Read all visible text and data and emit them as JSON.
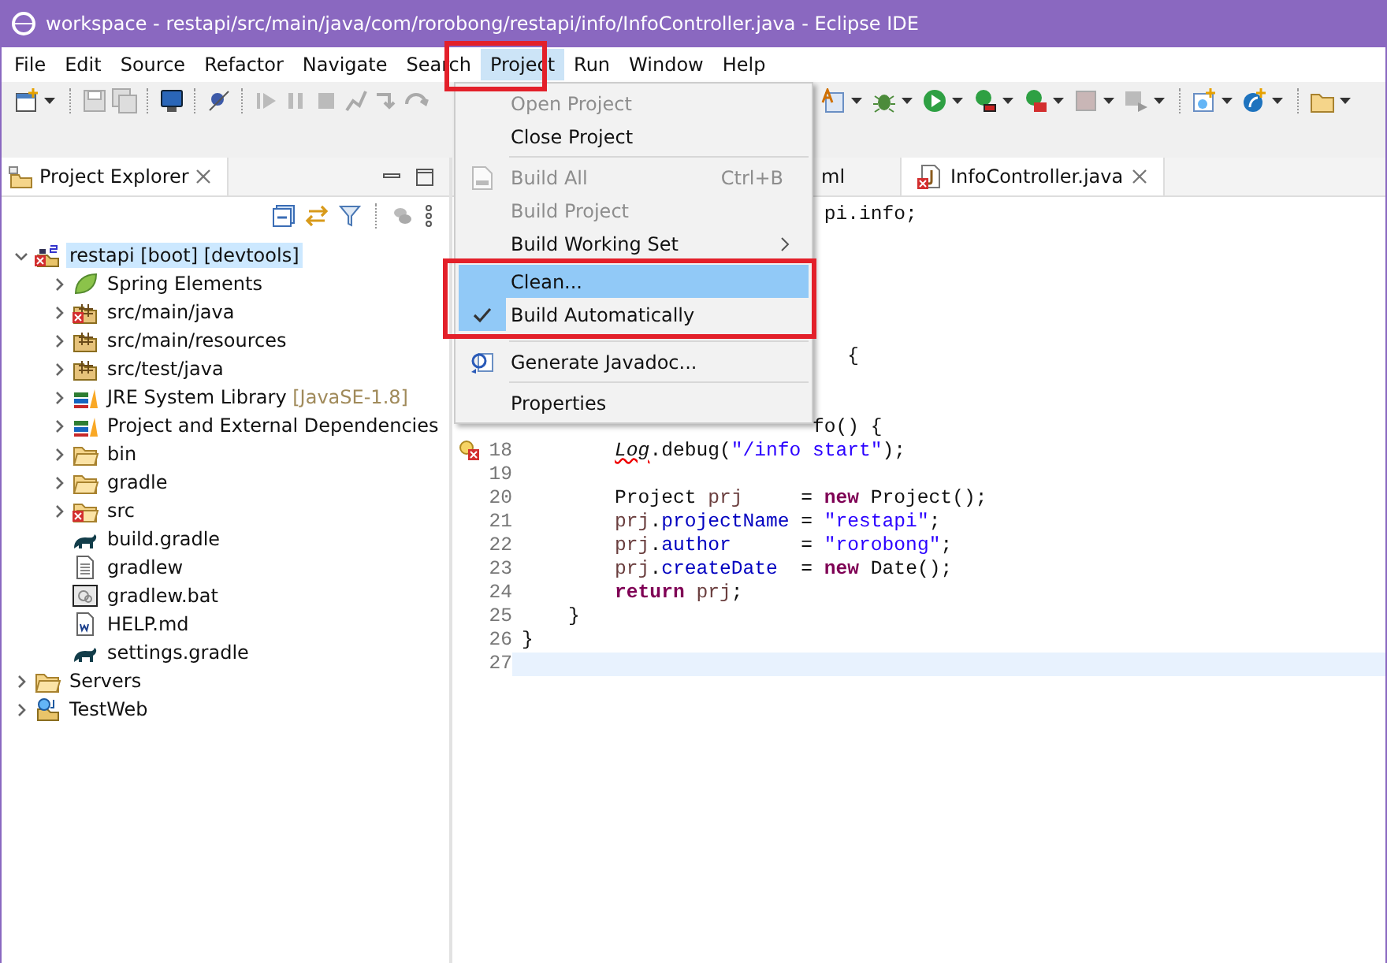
{
  "window": {
    "title": "workspace - restapi/src/main/java/com/rorobong/restapi/info/InfoController.java - Eclipse IDE"
  },
  "menubar": [
    {
      "label": "File",
      "selected": false
    },
    {
      "label": "Edit",
      "selected": false
    },
    {
      "label": "Source",
      "selected": false
    },
    {
      "label": "Refactor",
      "selected": false
    },
    {
      "label": "Navigate",
      "selected": false
    },
    {
      "label": "Search",
      "selected": false
    },
    {
      "label": "Project",
      "selected": true
    },
    {
      "label": "Run",
      "selected": false
    },
    {
      "label": "Window",
      "selected": false
    },
    {
      "label": "Help",
      "selected": false
    }
  ],
  "project_explorer": {
    "title": "Project Explorer",
    "tree": [
      {
        "label": "restapi [boot] [devtools]",
        "kind": "project",
        "error": true,
        "expanded": true,
        "selected": true,
        "children": [
          {
            "label": "Spring Elements",
            "kind": "spring",
            "expanded": false,
            "selected": false
          },
          {
            "label": "src/main/java",
            "kind": "package",
            "error": true,
            "expanded": false,
            "selected": false
          },
          {
            "label": "src/main/resources",
            "kind": "package",
            "expanded": false,
            "selected": false
          },
          {
            "label": "src/test/java",
            "kind": "package",
            "expanded": false,
            "selected": false
          },
          {
            "label": "JRE System Library",
            "decoration": "[JavaSE-1.8]",
            "kind": "library",
            "expanded": false,
            "selected": false
          },
          {
            "label": "Project and External Dependencies",
            "kind": "library",
            "expanded": false,
            "selected": false
          },
          {
            "label": "bin",
            "kind": "folder",
            "expanded": false,
            "selected": false
          },
          {
            "label": "gradle",
            "kind": "folder",
            "expanded": false,
            "selected": false
          },
          {
            "label": "src",
            "kind": "folder",
            "error": true,
            "expanded": false,
            "selected": false
          },
          {
            "label": "build.gradle",
            "kind": "gradle",
            "selected": false
          },
          {
            "label": "gradlew",
            "kind": "file",
            "selected": false
          },
          {
            "label": "gradlew.bat",
            "kind": "bat",
            "selected": false
          },
          {
            "label": "HELP.md",
            "kind": "doc",
            "selected": false
          },
          {
            "label": "settings.gradle",
            "kind": "gradle",
            "selected": false
          }
        ]
      },
      {
        "label": "Servers",
        "kind": "folder",
        "expanded": false,
        "selected": false
      },
      {
        "label": "TestWeb",
        "kind": "webproject",
        "expanded": false,
        "selected": false
      }
    ]
  },
  "editor": {
    "tabs": [
      {
        "label": "ml",
        "selected": false
      },
      {
        "label": "InfoController.java",
        "selected": true
      }
    ],
    "covered_lines": [
      {
        "text": "                          pi.info;"
      },
      {
        "text": "                            {"
      },
      {
        "text": "                         fo() {"
      }
    ],
    "lines": [
      {
        "number": "18",
        "error": true,
        "tokens": [
          {
            "kind": "static",
            "text": "        Log"
          },
          {
            "kind": "plain",
            "text": ".debug("
          },
          {
            "kind": "string",
            "text": "\"/info start\""
          },
          {
            "kind": "plain",
            "text": ");"
          }
        ]
      },
      {
        "number": "19"
      },
      {
        "number": "20",
        "tokens": [
          {
            "kind": "plain",
            "text": "        Project "
          },
          {
            "kind": "local",
            "text": "prj"
          },
          {
            "kind": "plain",
            "text": "     = "
          },
          {
            "kind": "keyword",
            "text": "new"
          },
          {
            "kind": "plain",
            "text": " Project();"
          }
        ]
      },
      {
        "number": "21",
        "tokens": [
          {
            "kind": "local",
            "text": "        prj"
          },
          {
            "kind": "plain",
            "text": "."
          },
          {
            "kind": "field",
            "text": "projectName"
          },
          {
            "kind": "plain",
            "text": " = "
          },
          {
            "kind": "string",
            "text": "\"restapi\""
          },
          {
            "kind": "plain",
            "text": ";"
          }
        ]
      },
      {
        "number": "22",
        "tokens": [
          {
            "kind": "local",
            "text": "        prj"
          },
          {
            "kind": "plain",
            "text": "."
          },
          {
            "kind": "field",
            "text": "author"
          },
          {
            "kind": "plain",
            "text": "      = "
          },
          {
            "kind": "string",
            "text": "\"rorobong\""
          },
          {
            "kind": "plain",
            "text": ";"
          }
        ]
      },
      {
        "number": "23",
        "tokens": [
          {
            "kind": "local",
            "text": "        prj"
          },
          {
            "kind": "plain",
            "text": "."
          },
          {
            "kind": "field",
            "text": "createDate"
          },
          {
            "kind": "plain",
            "text": "  = "
          },
          {
            "kind": "keyword",
            "text": "new"
          },
          {
            "kind": "plain",
            "text": " Date();"
          }
        ]
      },
      {
        "number": "24",
        "tokens": [
          {
            "kind": "keyword",
            "text": "        return"
          },
          {
            "kind": "local",
            "text": " prj"
          },
          {
            "kind": "plain",
            "text": ";"
          }
        ]
      },
      {
        "number": "25",
        "tokens": [
          {
            "kind": "plain",
            "text": "    }"
          }
        ]
      },
      {
        "number": "26",
        "tokens": [
          {
            "kind": "plain",
            "text": "}"
          }
        ]
      },
      {
        "number": "27",
        "current": true
      }
    ]
  },
  "project_menu": [
    {
      "kind": "item",
      "label": "Open Project",
      "disabled": true,
      "selected": false
    },
    {
      "kind": "item",
      "label": "Close Project",
      "disabled": false,
      "selected": false
    },
    {
      "kind": "separator"
    },
    {
      "kind": "item",
      "label": "Build All",
      "shortcut": "Ctrl+B",
      "disabled": true,
      "selected": false
    },
    {
      "kind": "item",
      "label": "Build Project",
      "disabled": true,
      "selected": false
    },
    {
      "kind": "item",
      "label": "Build Working Set",
      "submenu": true,
      "disabled": false,
      "selected": false
    },
    {
      "kind": "item",
      "label": "Clean...",
      "disabled": false,
      "selected": true
    },
    {
      "kind": "item",
      "label": "Build Automatically",
      "checked": true,
      "disabled": false,
      "selected": false
    },
    {
      "kind": "separator"
    },
    {
      "kind": "item",
      "label": "Generate Javadoc...",
      "disabled": false,
      "selected": false
    },
    {
      "kind": "separator"
    },
    {
      "kind": "item",
      "label": "Properties",
      "disabled": false,
      "selected": false
    }
  ]
}
